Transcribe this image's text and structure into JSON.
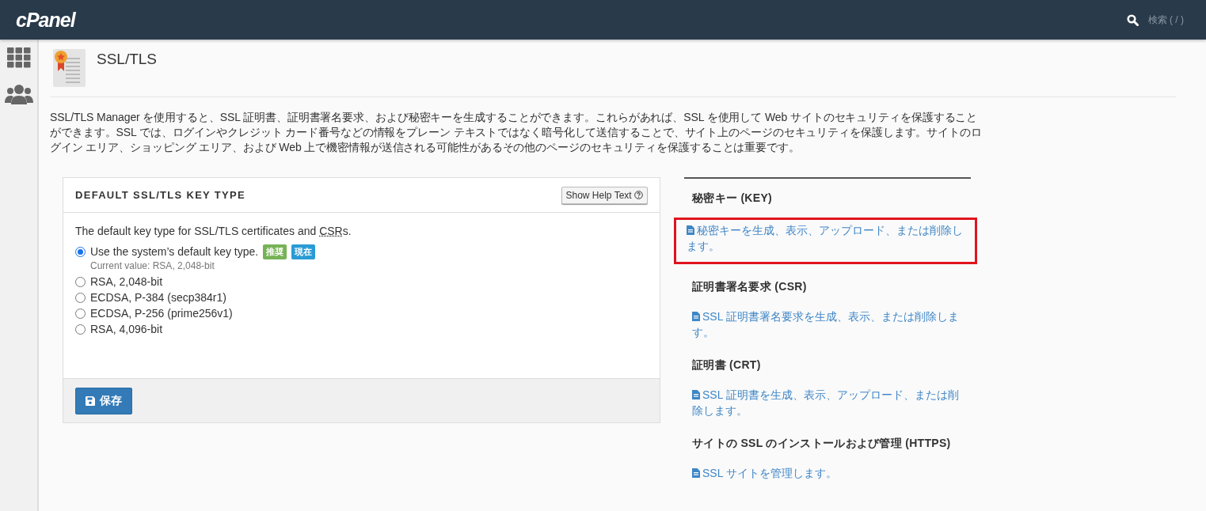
{
  "header": {
    "logo": "cPanel",
    "search_label": "検索 ( / )"
  },
  "page": {
    "title": "SSL/TLS",
    "description": "SSL/TLS Manager を使用すると、SSL 証明書、証明書署名要求、および秘密キーを生成することができます。これらがあれば、SSL を使用して Web サイトのセキュリティを保護することができます。SSL では、ログインやクレジット カード番号などの情報をプレーン テキストではなく暗号化して送信することで、サイト上のページのセキュリティを保護します。サイトのログイン エリア、ショッピング エリア、および Web 上で機密情報が送信される可能性があるその他のページのセキュリティを保護することは重要です。"
  },
  "key_type_panel": {
    "title": "DEFAULT SSL/TLS KEY TYPE",
    "help_button": "Show Help Text",
    "intro": {
      "before": "The default key type for SSL/TLS certificates and ",
      "abbreviation": "CSR",
      "after": "s."
    },
    "options": [
      {
        "label": "Use the system’s default key type.",
        "selected": true,
        "badges": [
          {
            "text": "推奨",
            "color": "#77b256"
          },
          {
            "text": "現在",
            "color": "#2a9bd5"
          }
        ],
        "note": "Current value: RSA, 2,048-bit"
      },
      {
        "label": "RSA, 2,048-bit",
        "selected": false
      },
      {
        "label": "ECDSA, P-384 (secp384r1)",
        "selected": false
      },
      {
        "label": "ECDSA, P-256 (prime256v1)",
        "selected": false
      },
      {
        "label": "RSA, 4,096-bit",
        "selected": false
      }
    ],
    "save_button": "保存"
  },
  "sections": [
    {
      "heading": "秘密キー (KEY)",
      "link": "秘密キーを生成、表示、アップロード、または削除します。",
      "highlighted": true
    },
    {
      "heading": "証明書署名要求 (CSR)",
      "link": "SSL 証明書署名要求を生成、表示、または削除します。",
      "highlighted": false
    },
    {
      "heading": "証明書 (CRT)",
      "link": "SSL 証明書を生成、表示、アップロード、または削除します。",
      "highlighted": false
    },
    {
      "heading": "サイトの SSL のインストールおよび管理 (HTTPS)",
      "link": "SSL サイトを管理します。",
      "highlighted": false
    }
  ]
}
